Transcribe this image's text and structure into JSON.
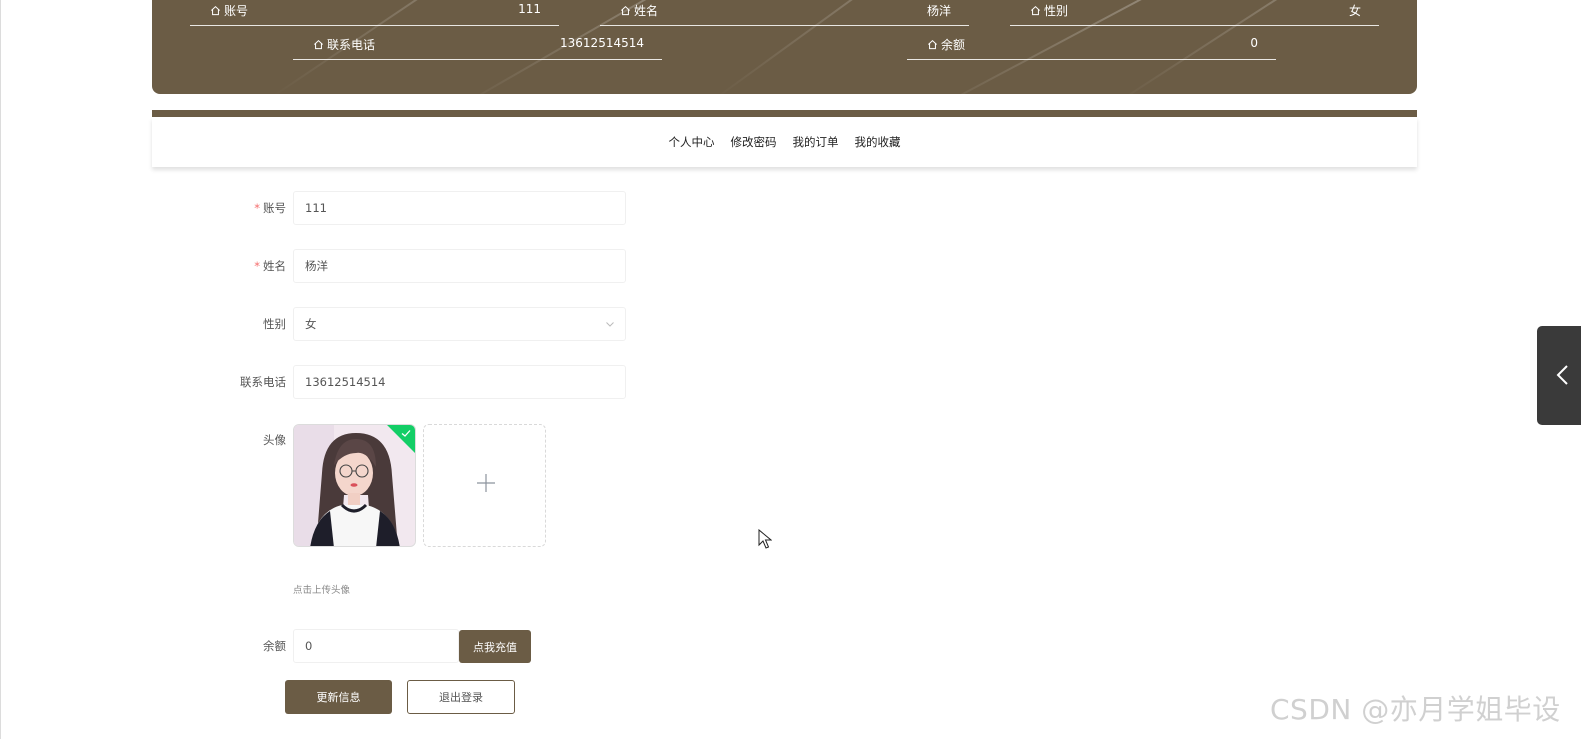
{
  "header": {
    "account_label": "账号",
    "account_value": "111",
    "name_label": "姓名",
    "name_value": "杨洋",
    "gender_label": "性别",
    "gender_value": "女",
    "phone_label": "联系电话",
    "phone_value": "13612514514",
    "balance_label": "余额",
    "balance_value": "0"
  },
  "nav": {
    "items": [
      "个人中心",
      "修改密码",
      "我的订单",
      "我的收藏"
    ]
  },
  "form": {
    "account": {
      "label": "账号",
      "required": "*",
      "value": "111"
    },
    "name": {
      "label": "姓名",
      "required": "*",
      "value": "杨洋"
    },
    "gender": {
      "label": "性别",
      "value": "女"
    },
    "phone": {
      "label": "联系电话",
      "value": "13612514514"
    },
    "avatar": {
      "label": "头像",
      "tip": "点击上传头像"
    },
    "balance": {
      "label": "余额",
      "value": "0",
      "recharge_label": "点我充值"
    }
  },
  "actions": {
    "update_label": "更新信息",
    "logout_label": "退出登录"
  },
  "watermark": "CSDN @亦月学姐毕设",
  "colors": {
    "brand": "#6b5c45",
    "required": "#f56c6c",
    "success": "#13ce66",
    "side_tab": "#3a3a3a"
  },
  "icons": [
    "home-icon",
    "chevron-down-icon",
    "plus-icon",
    "check-icon",
    "chevron-left-icon",
    "cursor-icon"
  ]
}
